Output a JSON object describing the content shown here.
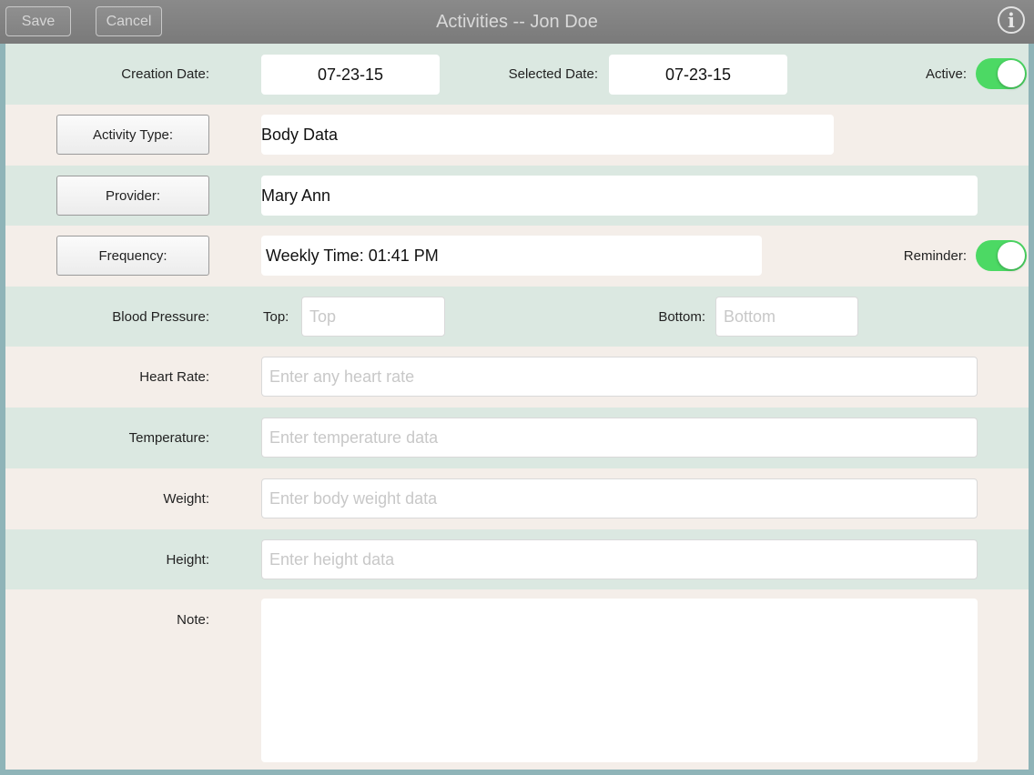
{
  "navbar": {
    "save_label": "Save",
    "cancel_label": "Cancel",
    "title": "Activities -- Jon Doe",
    "info_glyph": "i",
    "info_icon": "info-icon"
  },
  "form": {
    "creation_date": {
      "label": "Creation Date:",
      "value": "07-23-15"
    },
    "selected_date": {
      "label": "Selected Date:",
      "value": "07-23-15"
    },
    "active": {
      "label": "Active:",
      "on": true
    },
    "activity_type": {
      "button_label": "Activity Type:",
      "value": "Body Data"
    },
    "provider": {
      "button_label": "Provider:",
      "value": "Mary Ann"
    },
    "frequency": {
      "button_label": "Frequency:",
      "value": "Weekly Time: 01:41 PM"
    },
    "reminder": {
      "label": "Reminder:",
      "on": true
    },
    "blood_pressure": {
      "label": "Blood Pressure:",
      "top_label": "Top:",
      "top_placeholder": "Top",
      "bottom_label": "Bottom:",
      "bottom_placeholder": "Bottom"
    },
    "heart_rate": {
      "label": "Heart Rate:",
      "placeholder": "Enter any heart rate"
    },
    "temperature": {
      "label": "Temperature:",
      "placeholder": "Enter temperature data"
    },
    "weight": {
      "label": "Weight:",
      "placeholder": "Enter body weight data"
    },
    "height": {
      "label": "Height:",
      "placeholder": "Enter height data"
    },
    "note": {
      "label": "Note:",
      "value": ""
    }
  },
  "colors": {
    "row_green": "#dbe8e1",
    "row_pink": "#f4eee9",
    "toggle_on": "#4cd964",
    "navbar": "#7f7f7f"
  }
}
